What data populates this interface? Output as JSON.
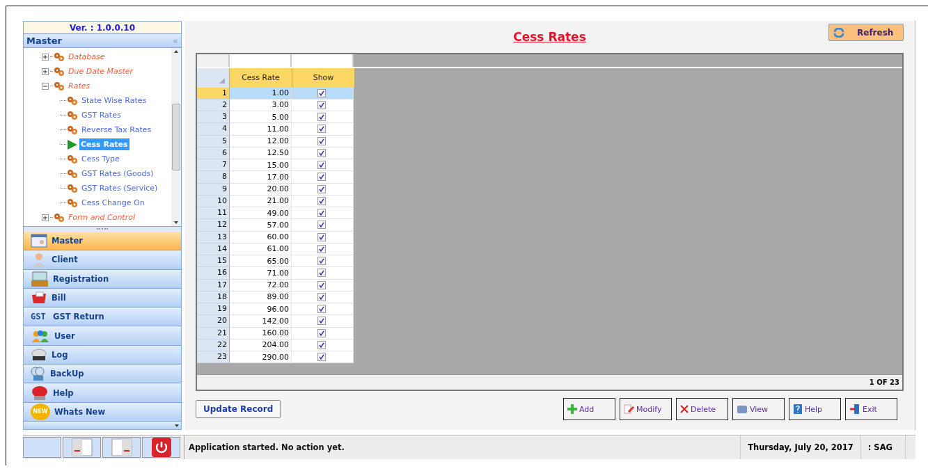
{
  "sidebar": {
    "version": "Ver. : 1.0.0.10",
    "header": "Master",
    "collapse_glyph": "«",
    "tree": [
      {
        "label": "Database",
        "expanded": false,
        "selected": false
      },
      {
        "label": "Due Date Master",
        "expanded": false,
        "selected": false
      },
      {
        "label": "Rates",
        "expanded": true,
        "selected": false,
        "children": [
          {
            "label": "State Wise Rates",
            "selected": false
          },
          {
            "label": "GST Rates",
            "selected": false
          },
          {
            "label": "Reverse Tax Rates",
            "selected": false
          },
          {
            "label": "Cess Rates",
            "selected": true
          },
          {
            "label": "Cess Type",
            "selected": false
          },
          {
            "label": "GST Rates (Goods)",
            "selected": false
          },
          {
            "label": "GST Rates (Service)",
            "selected": false
          },
          {
            "label": "Cess Change On",
            "selected": false
          }
        ]
      },
      {
        "label": "Form and Control",
        "expanded": false,
        "selected": false
      }
    ],
    "nav": [
      {
        "label": "Master",
        "kind": "master",
        "selected": true
      },
      {
        "label": "Client",
        "kind": "client",
        "selected": false
      },
      {
        "label": "Registration",
        "kind": "register",
        "selected": false
      },
      {
        "label": "Bill",
        "kind": "bill",
        "selected": false
      },
      {
        "label": "GST Return",
        "kind": "gst",
        "selected": false,
        "icon_text": "GST"
      },
      {
        "label": "User",
        "kind": "user",
        "selected": false
      },
      {
        "label": "Log",
        "kind": "log",
        "selected": false
      },
      {
        "label": "BackUp",
        "kind": "backup",
        "selected": false
      },
      {
        "label": "Help",
        "kind": "help",
        "selected": false
      },
      {
        "label": "Whats New",
        "kind": "new",
        "selected": false,
        "icon_text": "NEW"
      }
    ]
  },
  "title": "Cess Rates",
  "refresh_button": "Refresh",
  "table": {
    "columns": [
      "Cess Rate",
      "Show"
    ],
    "rows": [
      {
        "no": "1",
        "rate": "1.00",
        "show": true,
        "selected": true
      },
      {
        "no": "2",
        "rate": "3.00",
        "show": true,
        "selected": false
      },
      {
        "no": "3",
        "rate": "5.00",
        "show": true,
        "selected": false
      },
      {
        "no": "4",
        "rate": "11.00",
        "show": true,
        "selected": false
      },
      {
        "no": "5",
        "rate": "12.00",
        "show": true,
        "selected": false
      },
      {
        "no": "6",
        "rate": "12.50",
        "show": true,
        "selected": false
      },
      {
        "no": "7",
        "rate": "15.00",
        "show": true,
        "selected": false
      },
      {
        "no": "8",
        "rate": "17.00",
        "show": true,
        "selected": false
      },
      {
        "no": "9",
        "rate": "20.00",
        "show": true,
        "selected": false
      },
      {
        "no": "10",
        "rate": "21.00",
        "show": true,
        "selected": false
      },
      {
        "no": "11",
        "rate": "49.00",
        "show": true,
        "selected": false
      },
      {
        "no": "12",
        "rate": "57.00",
        "show": true,
        "selected": false
      },
      {
        "no": "13",
        "rate": "60.00",
        "show": true,
        "selected": false
      },
      {
        "no": "14",
        "rate": "61.00",
        "show": true,
        "selected": false
      },
      {
        "no": "15",
        "rate": "65.00",
        "show": true,
        "selected": false
      },
      {
        "no": "16",
        "rate": "71.00",
        "show": true,
        "selected": false
      },
      {
        "no": "17",
        "rate": "72.00",
        "show": true,
        "selected": false
      },
      {
        "no": "18",
        "rate": "89.00",
        "show": true,
        "selected": false
      },
      {
        "no": "19",
        "rate": "96.00",
        "show": true,
        "selected": false
      },
      {
        "no": "20",
        "rate": "142.00",
        "show": true,
        "selected": false
      },
      {
        "no": "21",
        "rate": "160.00",
        "show": true,
        "selected": false
      },
      {
        "no": "22",
        "rate": "204.00",
        "show": true,
        "selected": false
      },
      {
        "no": "23",
        "rate": "290.00",
        "show": true,
        "selected": false
      }
    ],
    "record_count": "1 OF 23"
  },
  "update_button": "Update Record",
  "actions": [
    {
      "label": "Add",
      "kind": "add"
    },
    {
      "label": "Modify",
      "kind": "modify"
    },
    {
      "label": "Delete",
      "kind": "delete"
    },
    {
      "label": "View",
      "kind": "view"
    },
    {
      "label": "Help",
      "kind": "help"
    },
    {
      "label": "Exit",
      "kind": "exit"
    }
  ],
  "status_bar": {
    "message": "Application started. No action yet.",
    "date": "Thursday, July 20, 2017",
    "user": ": SAG"
  }
}
